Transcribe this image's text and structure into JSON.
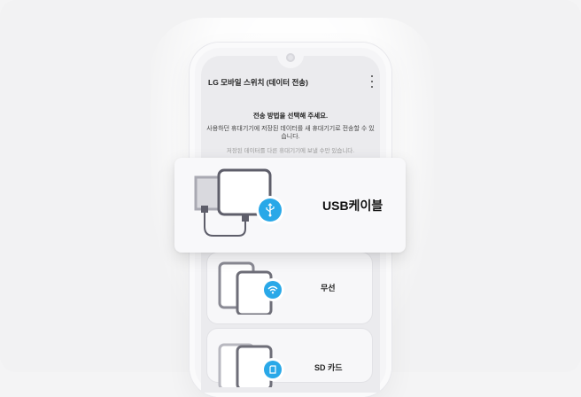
{
  "app": {
    "title": "LG 모바일 스위치 (데이터 전송)"
  },
  "instruction": {
    "heading": "전송 방법을 선택해 주세요.",
    "body": "사용하던 휴대기기에 저장된 데이터를 새 휴대기기로 전송할 수 있습니다.",
    "note": "저장된 데이터를 다른 휴대기기에 보낼 수만 있습니다."
  },
  "options": [
    {
      "label": "USB케이블",
      "icon": "usb-icon",
      "highlighted": true
    },
    {
      "label": "무선",
      "icon": "wifi-icon",
      "highlighted": false
    },
    {
      "label": "SD 카드",
      "icon": "sd-card-icon",
      "highlighted": false
    }
  ],
  "colors": {
    "accent": "#29a8e8",
    "background": "#f2f2f3",
    "device_frame": "#6e6e78"
  }
}
